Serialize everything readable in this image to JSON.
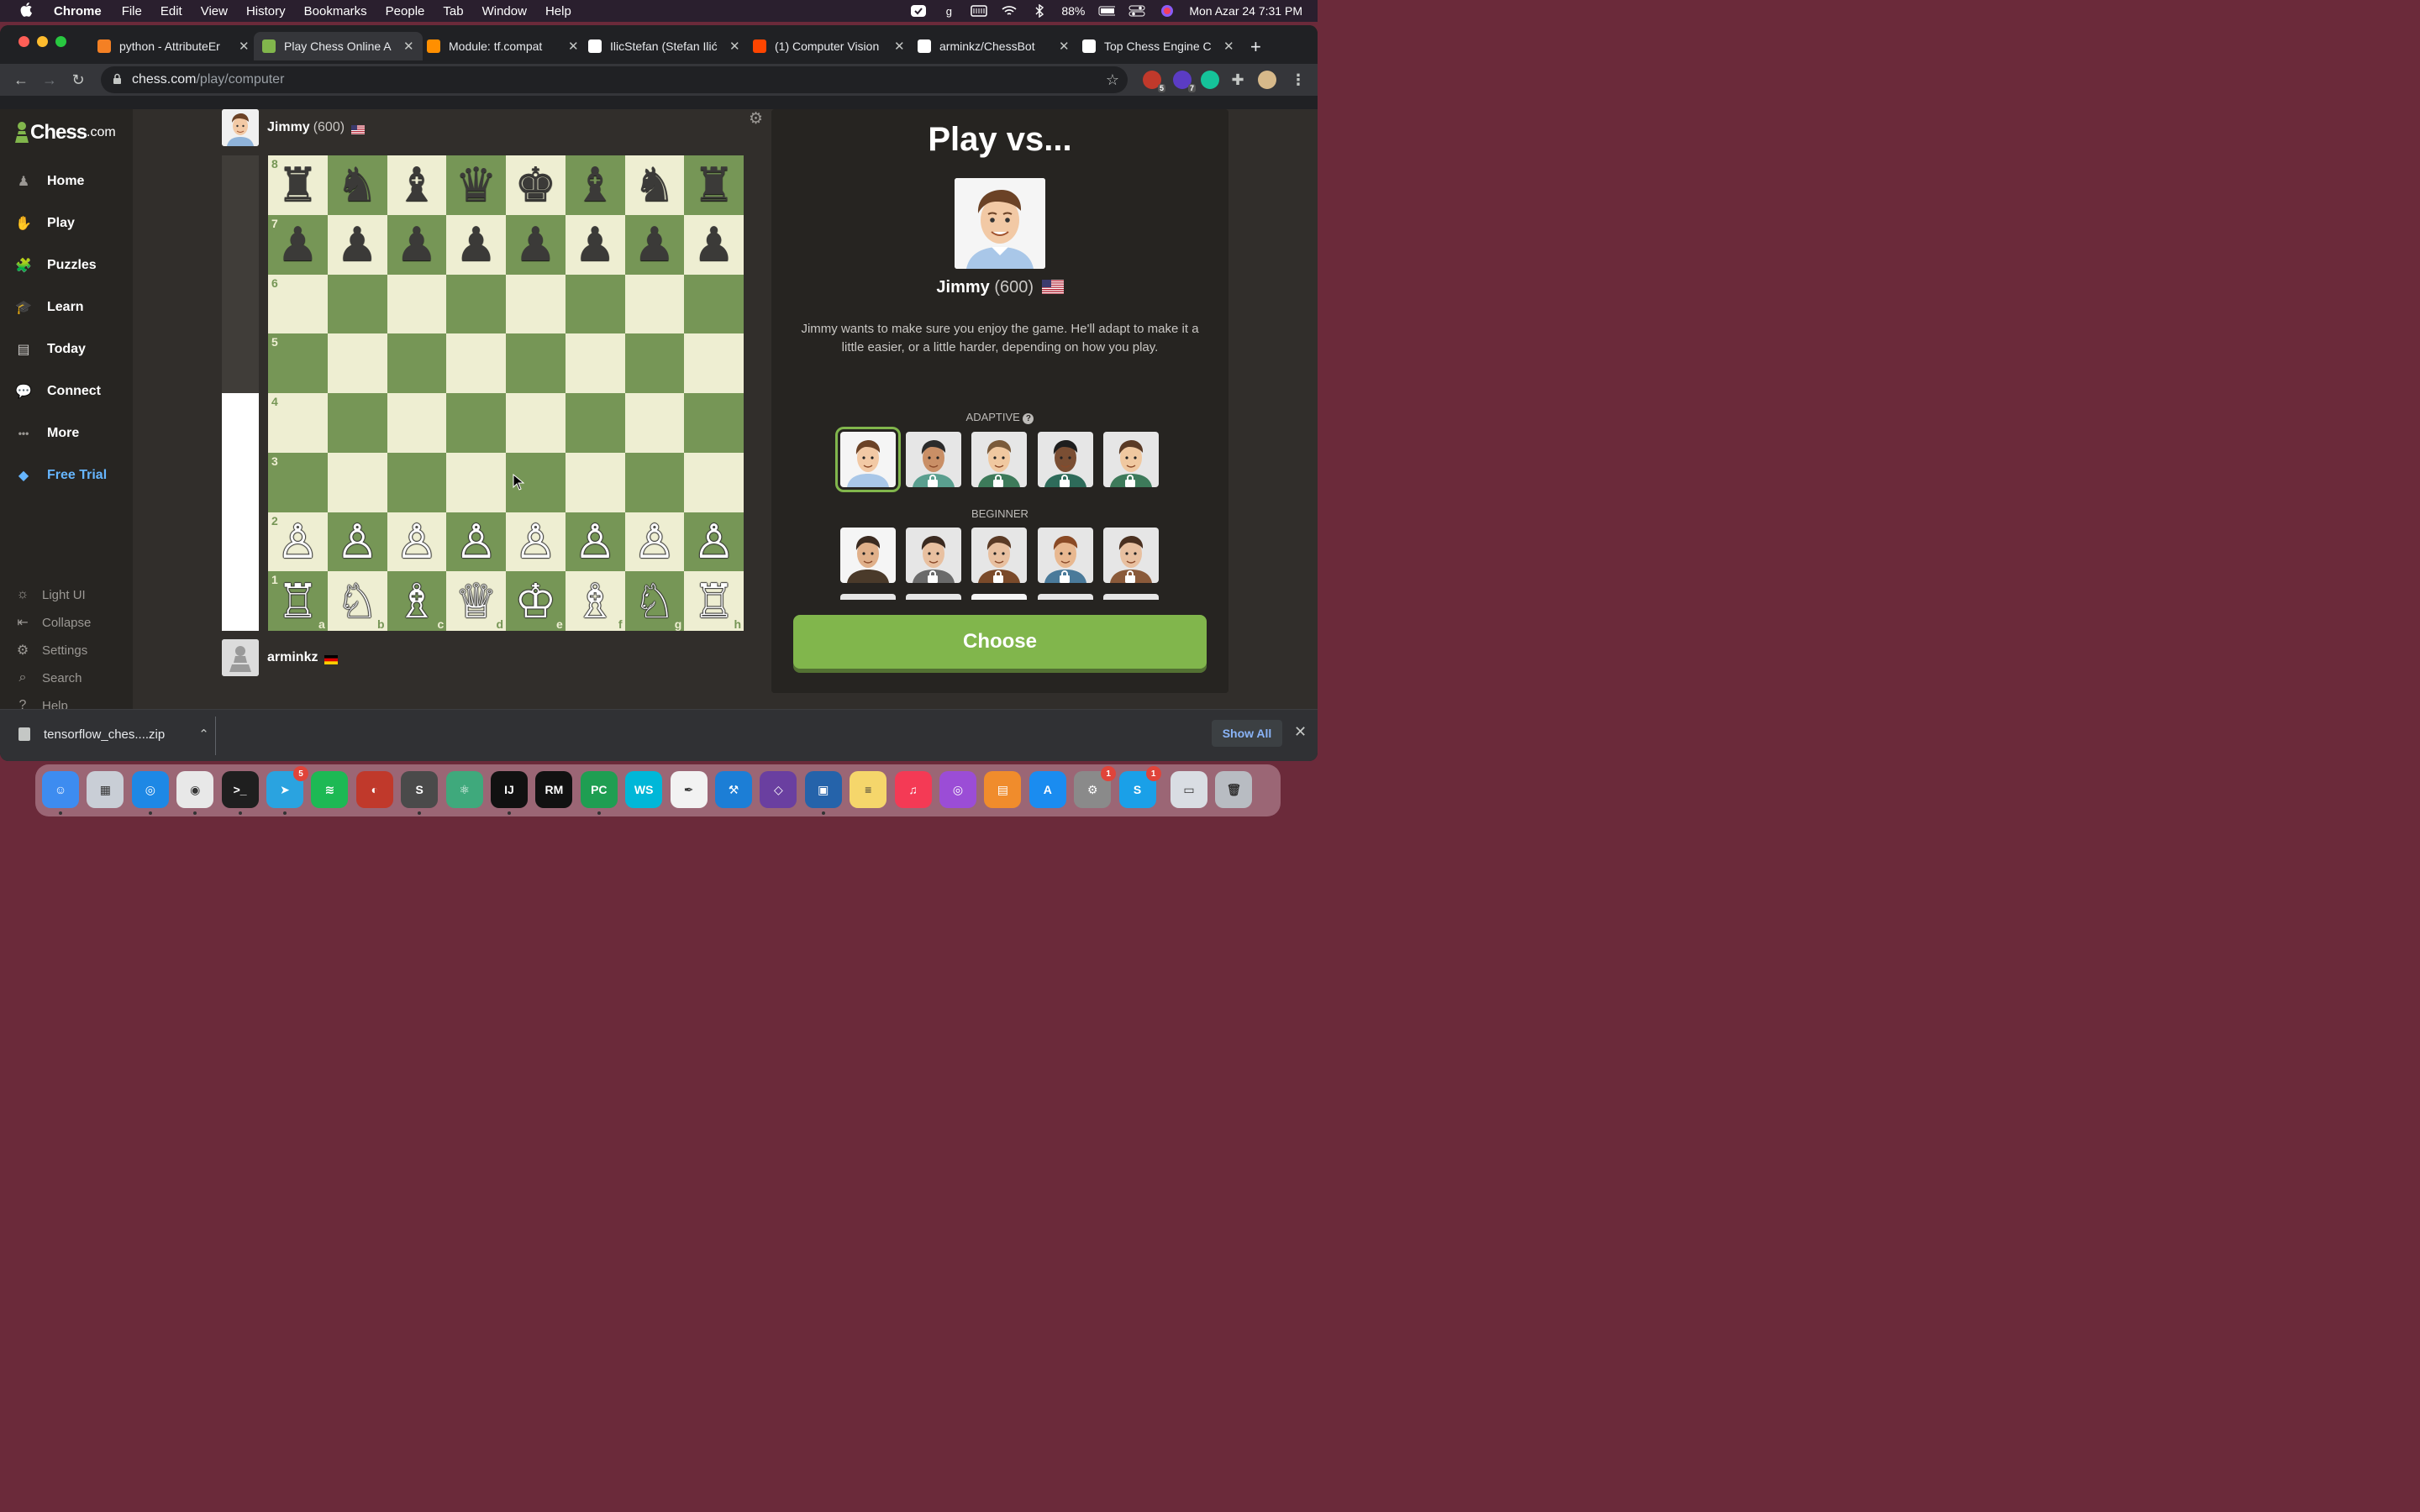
{
  "menubar": {
    "app": "Chrome",
    "items": [
      "File",
      "Edit",
      "View",
      "History",
      "Bookmarks",
      "People",
      "Tab",
      "Window",
      "Help"
    ],
    "battery": "88%",
    "datetime": "Mon Azar 24  7:31 PM"
  },
  "tabs": [
    {
      "title": "python - AttributeEr",
      "icon": "stackoverflow-icon",
      "color": "#f48024"
    },
    {
      "title": "Play Chess Online A",
      "icon": "chess-pawn-icon",
      "color": "#81b64c"
    },
    {
      "title": "Module: tf.compat",
      "icon": "tensorflow-icon",
      "color": "#ff8f00"
    },
    {
      "title": "IlicStefan (Stefan Ilić",
      "icon": "github-icon",
      "color": "#ffffff"
    },
    {
      "title": "(1) Computer Vision",
      "icon": "reddit-icon",
      "color": "#ff4500"
    },
    {
      "title": "arminkz/ChessBot",
      "icon": "github-icon",
      "color": "#ffffff"
    },
    {
      "title": "Top Chess Engine C",
      "icon": "wikipedia-icon",
      "color": "#ffffff"
    }
  ],
  "address": {
    "domain": "chess.com",
    "path": "/play/computer"
  },
  "extensions": [
    {
      "name": "adblock-extension-icon",
      "badge": "5",
      "color": "#c0392b"
    },
    {
      "name": "extension-icon",
      "badge": "7",
      "color": "#5b3cc4"
    },
    {
      "name": "grammarly-extension-icon",
      "badge": "",
      "color": "#15c39a"
    }
  ],
  "sidebar": {
    "logo": "Chess",
    "logo_suffix": ".com",
    "items": [
      {
        "label": "Home",
        "icon": "home-icon"
      },
      {
        "label": "Play",
        "icon": "play-hand-icon"
      },
      {
        "label": "Puzzles",
        "icon": "puzzle-icon"
      },
      {
        "label": "Learn",
        "icon": "graduation-cap-icon"
      },
      {
        "label": "Today",
        "icon": "newspaper-icon"
      },
      {
        "label": "Connect",
        "icon": "chat-bubbles-icon"
      },
      {
        "label": "More",
        "icon": "more-dots-icon"
      },
      {
        "label": "Free Trial",
        "icon": "diamond-icon"
      }
    ],
    "bottom": [
      {
        "label": "Light UI",
        "icon": "sun-icon"
      },
      {
        "label": "Collapse",
        "icon": "collapse-icon"
      },
      {
        "label": "Settings",
        "icon": "gear-icon"
      },
      {
        "label": "Search",
        "icon": "search-icon"
      },
      {
        "label": "Help",
        "icon": "help-icon"
      }
    ]
  },
  "opponent": {
    "name": "Jimmy",
    "rating": "(600)"
  },
  "me": {
    "name": "arminkz"
  },
  "evaluation": {
    "white_fraction": 0.5
  },
  "board": {
    "ranks": [
      "8",
      "7",
      "6",
      "5",
      "4",
      "3",
      "2",
      "1"
    ],
    "files": [
      "a",
      "b",
      "c",
      "d",
      "e",
      "f",
      "g",
      "h"
    ],
    "position": [
      [
        "♜",
        "♞",
        "♝",
        "♛",
        "♚",
        "♝",
        "♞",
        "♜"
      ],
      [
        "♟",
        "♟",
        "♟",
        "♟",
        "♟",
        "♟",
        "♟",
        "♟"
      ],
      [
        "",
        "",
        "",
        "",
        "",
        "",
        "",
        ""
      ],
      [
        "",
        "",
        "",
        "",
        "",
        "",
        "",
        ""
      ],
      [
        "",
        "",
        "",
        "",
        "",
        "",
        "",
        ""
      ],
      [
        "",
        "",
        "",
        "",
        "",
        "",
        "",
        ""
      ],
      [
        "♙",
        "♙",
        "♙",
        "♙",
        "♙",
        "♙",
        "♙",
        "♙"
      ],
      [
        "♖",
        "♘",
        "♗",
        "♕",
        "♔",
        "♗",
        "♘",
        "♖"
      ]
    ]
  },
  "panel": {
    "title": "Play vs...",
    "bot_name": "Jimmy",
    "bot_rating": "(600)",
    "description": "Jimmy wants to make sure you enjoy the game. He'll adapt to make it a little easier, or a little harder, depending on how you play.",
    "adaptive_label": "ADAPTIVE",
    "beginner_label": "BEGINNER",
    "choose_label": "Choose"
  },
  "download": {
    "filename": "tensorflow_ches....zip",
    "show_all": "Show All"
  },
  "dock": [
    {
      "name": "finder-icon",
      "color": "#3d8cf0",
      "glyph": "☺",
      "running": true
    },
    {
      "name": "launchpad-icon",
      "color": "#c9ced6",
      "glyph": "▦",
      "running": false
    },
    {
      "name": "safari-icon",
      "color": "#1e88e5",
      "glyph": "◎",
      "running": true
    },
    {
      "name": "chrome-icon",
      "color": "#e8e8e8",
      "glyph": "◉",
      "running": true
    },
    {
      "name": "terminal-icon",
      "color": "#1f1f1f",
      "glyph": ">_",
      "running": true
    },
    {
      "name": "telegram-icon",
      "color": "#2aa3e0",
      "glyph": "➤",
      "badge": "5",
      "running": true
    },
    {
      "name": "spotify-icon",
      "color": "#1db954",
      "glyph": "≋",
      "running": false
    },
    {
      "name": "screen-recorder-icon",
      "color": "#c0392b",
      "glyph": "◐",
      "running": false
    },
    {
      "name": "sublime-text-icon",
      "color": "#4a4a4a",
      "glyph": "S",
      "running": true
    },
    {
      "name": "atom-icon",
      "color": "#3fa97c",
      "glyph": "⚛",
      "running": false
    },
    {
      "name": "intellij-icon",
      "color": "#111111",
      "glyph": "IJ",
      "running": true
    },
    {
      "name": "rubymine-icon",
      "color": "#111111",
      "glyph": "RM",
      "running": false
    },
    {
      "name": "pycharm-icon",
      "color": "#1f9e52",
      "glyph": "PC",
      "running": true
    },
    {
      "name": "webstorm-icon",
      "color": "#00b7d8",
      "glyph": "WS",
      "running": false
    },
    {
      "name": "inkscape-icon",
      "color": "#f2f2f2",
      "glyph": "✒",
      "running": false
    },
    {
      "name": "xcode-icon",
      "color": "#1c7ed6",
      "glyph": "⚒",
      "running": false
    },
    {
      "name": "visual-studio-icon",
      "color": "#6a3fa0",
      "glyph": "◇",
      "running": false
    },
    {
      "name": "virtual-machine-icon",
      "color": "#2563aa",
      "glyph": "▣",
      "running": true
    },
    {
      "name": "notes-icon",
      "color": "#f5d66b",
      "glyph": "≡",
      "running": false
    },
    {
      "name": "music-icon",
      "color": "#f43a55",
      "glyph": "♫",
      "running": false
    },
    {
      "name": "podcasts-icon",
      "color": "#9b4dd6",
      "glyph": "◎",
      "running": false
    },
    {
      "name": "books-icon",
      "color": "#f08c2c",
      "glyph": "▤",
      "running": false
    },
    {
      "name": "app-store-icon",
      "color": "#1a8cf0",
      "glyph": "A",
      "running": false
    },
    {
      "name": "system-preferences-icon",
      "color": "#8a8a8a",
      "glyph": "⚙",
      "badge": "1",
      "running": false
    },
    {
      "name": "skype-icon",
      "color": "#1aa0e8",
      "glyph": "S",
      "badge": "1",
      "running": false
    },
    {
      "name": "documents-folder-icon",
      "color": "#d9dde3",
      "glyph": "▭",
      "running": false
    },
    {
      "name": "trash-icon",
      "color": "#b8bcc2",
      "glyph": "🗑",
      "running": false
    }
  ]
}
